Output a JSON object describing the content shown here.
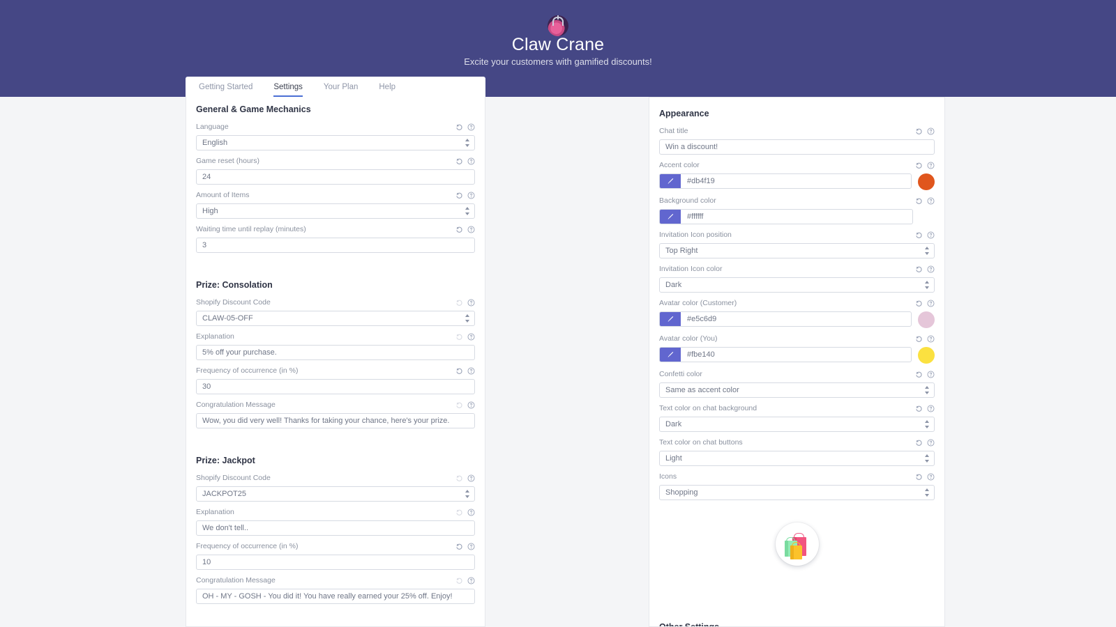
{
  "header": {
    "title": "Claw Crane",
    "subtitle": "Excite your customers with gamified discounts!",
    "logo_icon": "claw-crane-icon",
    "bg_color": "#454785"
  },
  "tabs": [
    {
      "label": "Getting Started",
      "active": false
    },
    {
      "label": "Settings",
      "active": true
    },
    {
      "label": "Your Plan",
      "active": false
    },
    {
      "label": "Help",
      "active": false
    }
  ],
  "left_panel": {
    "sections": [
      {
        "title": "General & Game Mechanics",
        "fields": [
          {
            "label": "Language",
            "value": "English",
            "type": "select",
            "reset_enabled": true
          },
          {
            "label": "Game reset (hours)",
            "value": "24",
            "type": "text",
            "reset_enabled": true
          },
          {
            "label": "Amount of Items",
            "value": "High",
            "type": "select",
            "reset_enabled": true
          },
          {
            "label": "Waiting time until replay (minutes)",
            "value": "3",
            "type": "text",
            "reset_enabled": true
          }
        ]
      },
      {
        "title": "Prize: Consolation",
        "fields": [
          {
            "label": "Shopify Discount Code",
            "value": "CLAW-05-OFF",
            "type": "select",
            "reset_enabled": false
          },
          {
            "label": "Explanation",
            "value": "5% off your purchase.",
            "type": "text",
            "reset_enabled": false
          },
          {
            "label": "Frequency of occurrence (in %)",
            "value": "30",
            "type": "text",
            "reset_enabled": true
          },
          {
            "label": "Congratulation Message",
            "value": "Wow, you did very well! Thanks for taking your chance, here's your prize.",
            "type": "text",
            "reset_enabled": false
          }
        ]
      },
      {
        "title": "Prize: Jackpot",
        "fields": [
          {
            "label": "Shopify Discount Code",
            "value": "JACKPOT25",
            "type": "select",
            "reset_enabled": false
          },
          {
            "label": "Explanation",
            "value": "We don't tell..",
            "type": "text",
            "reset_enabled": false
          },
          {
            "label": "Frequency of occurrence (in %)",
            "value": "10",
            "type": "text",
            "reset_enabled": true
          },
          {
            "label": "Congratulation Message",
            "value": "OH - MY - GOSH - You did it! You have really earned your 25% off. Enjoy!",
            "type": "text",
            "reset_enabled": false
          }
        ]
      }
    ]
  },
  "right_panel": {
    "section_title": "Appearance",
    "fields": [
      {
        "label": "Chat title",
        "value": "Win a discount!",
        "type": "text",
        "reset_enabled": true
      },
      {
        "label": "Accent color",
        "value": "#db4f19",
        "type": "color",
        "swatch": "#e0561d",
        "reset_enabled": true
      },
      {
        "label": "Background color",
        "value": "#ffffff",
        "type": "color",
        "swatch": null,
        "reset_enabled": true
      },
      {
        "label": "Invitation Icon position",
        "value": "Top Right",
        "type": "select",
        "reset_enabled": true
      },
      {
        "label": "Invitation Icon color",
        "value": "Dark",
        "type": "select",
        "reset_enabled": true
      },
      {
        "label": "Avatar color (Customer)",
        "value": "#e5c6d9",
        "type": "color",
        "swatch": "#e5c6d9",
        "reset_enabled": true
      },
      {
        "label": "Avatar color (You)",
        "value": "#fbe140",
        "type": "color",
        "swatch": "#fbe140",
        "reset_enabled": true
      },
      {
        "label": "Confetti color",
        "value": "Same as accent color",
        "type": "select",
        "reset_enabled": true
      },
      {
        "label": "Text color on chat background",
        "value": "Dark",
        "type": "select",
        "reset_enabled": true
      },
      {
        "label": "Text color on chat buttons",
        "value": "Light",
        "type": "select",
        "reset_enabled": true
      },
      {
        "label": "Icons",
        "value": "Shopping",
        "type": "select",
        "reset_enabled": true
      }
    ],
    "icon_preview_name": "shopping-bags-icon"
  },
  "icons": {
    "reset": "reset-arrow-icon",
    "help": "help-circle-icon",
    "brush": "brush-icon"
  },
  "colors": {
    "header_purple": "#454785",
    "brush_button": "#6166cf",
    "tab_underline": "#4a6fd4",
    "page_background": "#f4f5f7"
  }
}
